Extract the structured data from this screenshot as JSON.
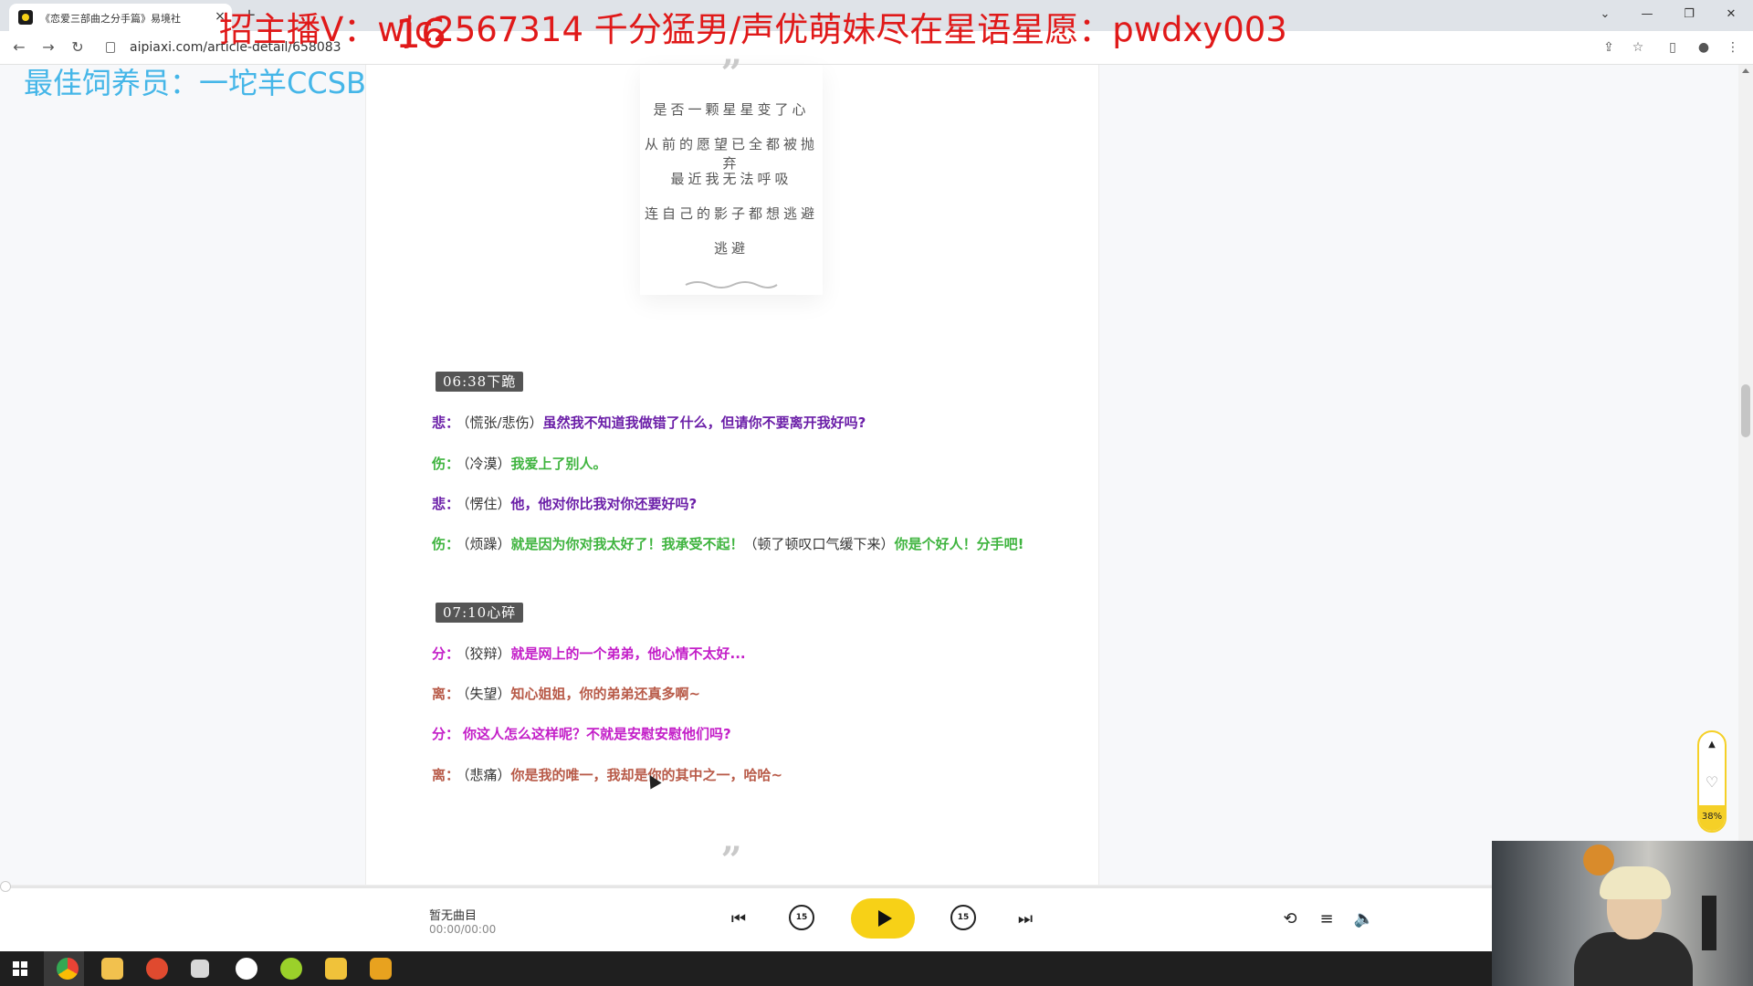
{
  "browser": {
    "tab_title": "《恋爱三部曲之分手篇》易境社",
    "tab_close": "×",
    "new_tab": "+",
    "url": "aipiaxi.com/article-detail/658083",
    "window_controls": {
      "dropdown": "⌄",
      "minimize": "—",
      "restore": "❐",
      "close": "✕"
    },
    "nav": {
      "back": "←",
      "forward": "→",
      "reload": "↻"
    },
    "toolbar_icons": {
      "share": "⇪",
      "bookmark": "☆",
      "sidebar": "▯",
      "profile": "●",
      "menu": "⋮"
    }
  },
  "overlays": {
    "banner": "招主播V：wjc2567314   千分猛男/声优萌妹尽在星语星愿：pwdxy003",
    "big_number": "16",
    "feeder": "最佳饲养员：一坨羊CCSB"
  },
  "article": {
    "quote_open": "”",
    "poem": [
      "是否一颗星星变了心",
      "从前的愿望已全都被抛弃",
      "最近我无法呼吸",
      "连自己的影子都想逃避",
      "逃避"
    ],
    "quote_bottom": "”",
    "sections": [
      {
        "tag": "06:38下跪",
        "lines": [
          {
            "speaker": "悲：",
            "paren": "（慌张/悲伤）",
            "text": "虽然我不知道我做错了什么，但请你不要离开我好吗?"
          },
          {
            "speaker": "伤：",
            "paren": "（冷漠）",
            "text": "我爱上了别人。"
          },
          {
            "speaker": "悲：",
            "paren": "（愣住）",
            "text": "他，他对你比我对你还要好吗?"
          },
          {
            "speaker": "伤：",
            "paren": "（烦躁）",
            "text": "就是因为你对我太好了！我承受不起！",
            "paren2": "（顿了顿叹口气缓下来）",
            "text2": "你是个好人！分手吧!"
          }
        ]
      },
      {
        "tag": "07:10心碎",
        "lines": [
          {
            "speaker": "分：",
            "paren": "（狡辩）",
            "text": "就是网上的一个弟弟，他心情不太好..."
          },
          {
            "speaker": "离：",
            "paren": "（失望）",
            "text": "知心姐姐，你的弟弟还真多啊~"
          },
          {
            "speaker": "分：",
            "paren": "",
            "text": "你这人怎么这样呢？不就是安慰安慰他们吗?"
          },
          {
            "speaker": "离：",
            "paren": "（悲痛）",
            "text": "你是我的唯一，我却是你的其中之一，哈哈~"
          }
        ]
      }
    ]
  },
  "side_widget": {
    "top_icon": "▲",
    "heart": "♡",
    "progress_percent": "38%"
  },
  "player": {
    "track_title": "暂无曲目",
    "track_time": "00:00/00:00",
    "skip_back": "15",
    "skip_forward": "15",
    "progress": 0,
    "icons": {
      "prev": "⏮",
      "next": "⏭",
      "repeat": "⟲",
      "playlist": "≡",
      "volume": "🔈"
    }
  },
  "colors": {
    "accent_yellow": "#f7d117",
    "speaker_bei": "#6b1fa8",
    "speaker_shang": "#3fb43f",
    "speaker_fen": "#c31ec8",
    "speaker_li": "#b85a48",
    "banner_red": "#e01919",
    "feeder_blue": "#45b6e8"
  },
  "taskbar": {
    "apps": [
      "windows-start",
      "chrome",
      "file-explorer",
      "app-red",
      "app-plane",
      "app-g",
      "app-green",
      "app-owl",
      "app-g-red"
    ]
  }
}
